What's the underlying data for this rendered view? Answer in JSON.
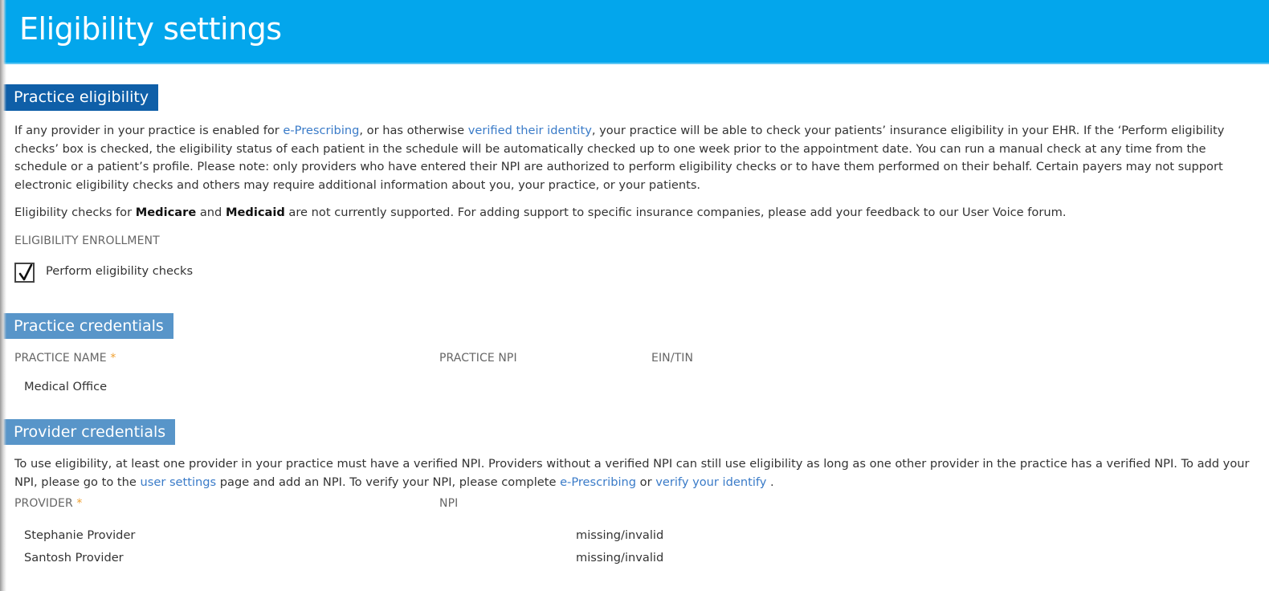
{
  "page": {
    "title": "Eligibility settings",
    "accent_color": "#03a6ec",
    "link_color": "#3a7bc8"
  },
  "practice_eligibility": {
    "header": "Practice eligibility",
    "intro": {
      "t1": "If any provider in your practice is enabled for ",
      "link1": "e-Prescribing",
      "t2": ", or has otherwise ",
      "link2": "verified their identity",
      "t3": ", your practice will be able to check your patients’ insurance eligibility in your EHR. If the ‘Perform eligibility checks’ box is checked, the eligibility status of each patient in the schedule will be automatically checked up to one week prior to the appointment date. You can run a manual check at any time from the schedule or a patient’s profile. Please note: only providers who have entered their NPI are authorized to perform eligibility checks or to have them performed on their behalf. Certain payers may not support electronic eligibility checks and others may require additional information about you, your practice, or your patients."
    },
    "support_note": {
      "t1": "Eligibility checks for ",
      "b1": "Medicare",
      "t2": " and ",
      "b2": "Medicaid",
      "t3": " are not currently supported. For adding support to specific insurance companies, please add your feedback to our User Voice forum."
    },
    "enrollment_label": "ELIGIBILITY ENROLLMENT",
    "checkbox": {
      "label": "Perform eligibility checks",
      "checked": true,
      "icon": "checkmark-icon"
    }
  },
  "practice_credentials": {
    "header": "Practice credentials",
    "columns": {
      "name": "PRACTICE NAME",
      "npi": "PRACTICE NPI",
      "ein": "EIN/TIN"
    },
    "required_marker": "*",
    "values": {
      "name": "Medical Office",
      "npi": "",
      "ein": ""
    }
  },
  "provider_credentials": {
    "header": "Provider credentials",
    "intro": {
      "t1": "To use eligibility, at least one provider in your practice must have a verified NPI. Providers without a verified NPI can still use eligibility as long as one other provider in the practice has a verified NPI. To add your NPI, please go to the ",
      "link1": "user settings",
      "t2": " page and add an NPI. To verify your NPI, please complete ",
      "link2": "e-Prescribing",
      "t3": " or ",
      "link3": "verify your identify",
      "t4": " ."
    },
    "columns": {
      "provider": "PROVIDER",
      "npi": "NPI"
    },
    "required_marker": "*",
    "rows": [
      {
        "provider": "Stephanie Provider",
        "npi": "missing/invalid"
      },
      {
        "provider": "Santosh Provider",
        "npi": "missing/invalid"
      }
    ]
  }
}
